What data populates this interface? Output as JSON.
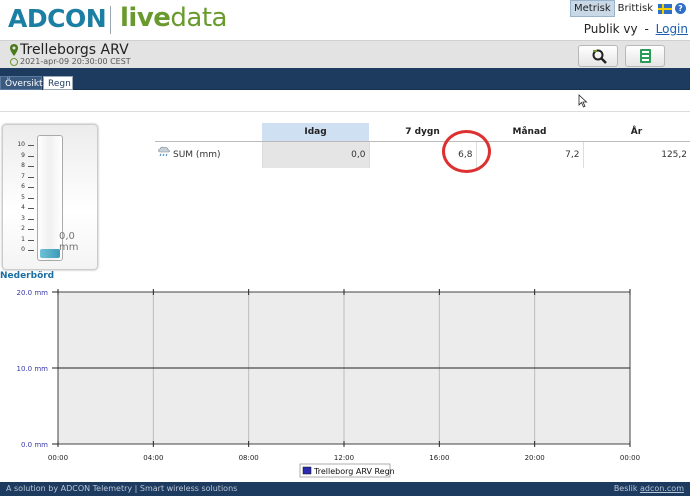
{
  "header": {
    "brand_adcon": "ADCON",
    "brand_live_strong": "live",
    "brand_live_light": "data",
    "unit_metric": "Metrisk",
    "unit_british": "Brittisk",
    "help": "?",
    "public_view": "Publik vy",
    "separator": "-",
    "login": "Login"
  },
  "station": {
    "name": "Trelleborgs ARV",
    "timestamp": "2021-apr-09 20:30:00 CEST"
  },
  "tabs": [
    {
      "label": "Översikt",
      "active": false
    },
    {
      "label": "Regn",
      "active": true
    }
  ],
  "gauge": {
    "ticks": [
      "10",
      "9",
      "8",
      "7",
      "6",
      "5",
      "4",
      "3",
      "2",
      "1",
      "0"
    ],
    "value_text": "0,0 mm",
    "fill_fraction": 0.07
  },
  "table": {
    "columns": [
      "Idag",
      "7 dygn",
      "Månad",
      "År"
    ],
    "row_label": "SUM (mm)",
    "values": [
      "0,0",
      "6,8",
      "7,2",
      "125,2"
    ]
  },
  "chart_data": {
    "type": "line",
    "title": "Nederbörd",
    "x_ticks": [
      "00:00",
      "04:00",
      "08:00",
      "12:00",
      "16:00",
      "20:00",
      "00:00"
    ],
    "y_ticks": [
      "20.0 mm",
      "10.0 mm",
      "0.0 mm"
    ],
    "ylim": [
      0,
      20
    ],
    "series": [
      {
        "name": "Trelleborg ARV Regn",
        "values": []
      }
    ],
    "grid": true,
    "legend": "bottom"
  },
  "footer": {
    "left": "A solution by ADCON Telemetry | Smart wireless solutions",
    "right_prefix": "Beslik",
    "right_link": "adcon.com"
  },
  "colors": {
    "brand_blue": "#1b7fa3",
    "brand_green": "#6a9a2e",
    "nav": "#1d3a5f",
    "annotation": "#dd3030",
    "series": "#2b2bb0"
  }
}
